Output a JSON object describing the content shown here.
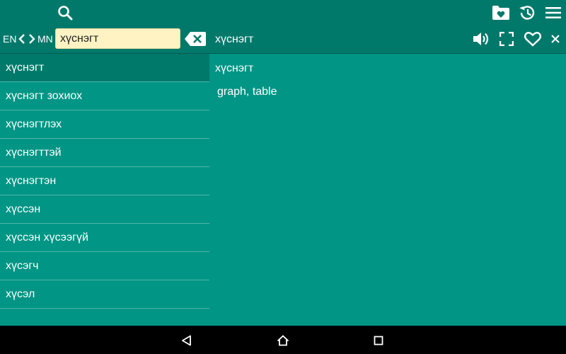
{
  "toolbar": {
    "icons": [
      "search-icon",
      "favorites-folder-icon",
      "history-icon",
      "menu-icon"
    ]
  },
  "search": {
    "source_lang": "EN",
    "target_lang": "MN",
    "value": "хүснэгт"
  },
  "entry": {
    "headword": "хүснэгт",
    "word": "хүснэгт",
    "translation": "graph, table",
    "actions": [
      "speaker-icon",
      "fullscreen-icon",
      "heart-icon",
      "close-icon"
    ]
  },
  "results": [
    {
      "label": "хүснэгт",
      "selected": true
    },
    {
      "label": "хүснэгт зохиох"
    },
    {
      "label": "хүснэгтлэх"
    },
    {
      "label": "хүснэгттэй"
    },
    {
      "label": "хүснэгтэн"
    },
    {
      "label": "хүссэн"
    },
    {
      "label": "хүссэн хүсээгүй"
    },
    {
      "label": "хүсэгч"
    },
    {
      "label": "хүсэл"
    }
  ],
  "navbar": {
    "icons": [
      "back-icon",
      "home-icon",
      "recents-icon"
    ]
  },
  "colors": {
    "background": "#009585",
    "toolbar": "#00796b",
    "selected_row": "#00796b",
    "search_field": "#fff3c4"
  }
}
